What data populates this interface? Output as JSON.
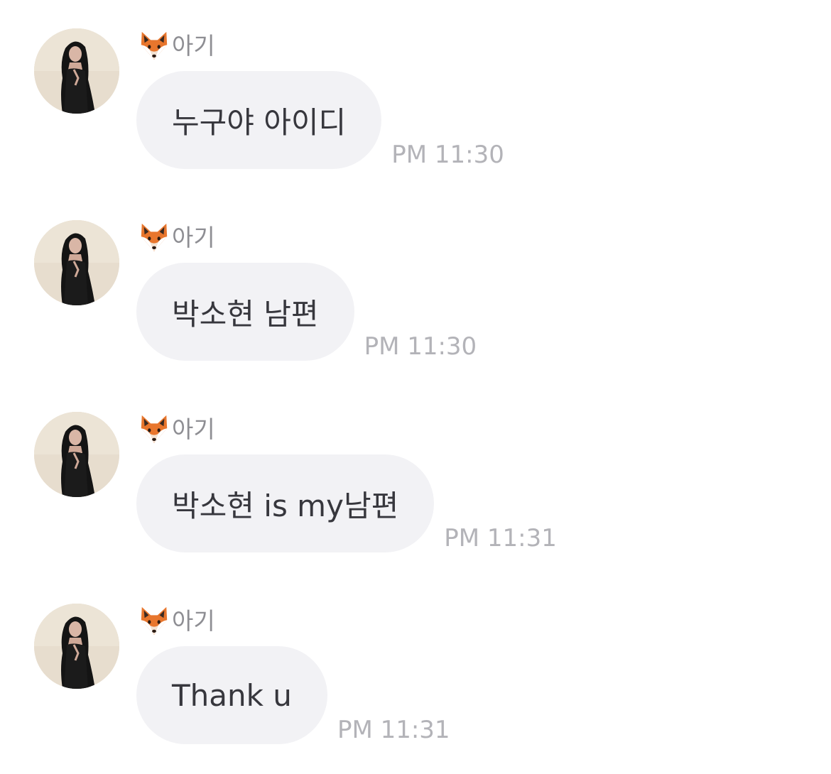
{
  "messages": [
    {
      "sender": "아기",
      "sender_emoji": "fox-face",
      "text": "누구야 아이디",
      "time": "PM 11:30"
    },
    {
      "sender": "아기",
      "sender_emoji": "fox-face",
      "text": "박소현 남편",
      "time": "PM 11:30"
    },
    {
      "sender": "아기",
      "sender_emoji": "fox-face",
      "text": "박소현 is my남편",
      "time": "PM 11:31"
    },
    {
      "sender": "아기",
      "sender_emoji": "fox-face",
      "text": "Thank u",
      "time": "PM 11:31"
    }
  ],
  "colors": {
    "bubble": "#f2f2f5",
    "text": "#37373d",
    "time": "#b3b3b8",
    "sender": "#8e8e93"
  }
}
